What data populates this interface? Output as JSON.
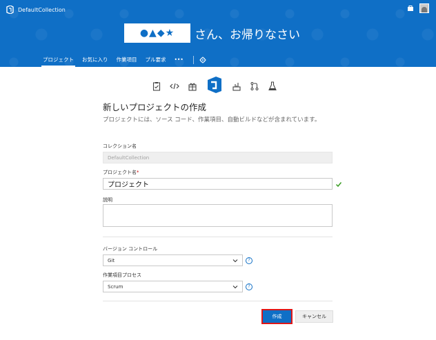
{
  "header": {
    "collection_name": "DefaultCollection",
    "user_name_masked": "●▲◆★",
    "welcome_text": "さん、お帰りなさい",
    "nav": [
      {
        "label": "プロジェクト"
      },
      {
        "label": "お気に入り"
      },
      {
        "label": "作業項目"
      },
      {
        "label": "プル要求"
      },
      {
        "label": "•••"
      }
    ]
  },
  "form": {
    "title": "新しいプロジェクトの作成",
    "description": "プロジェクトには、ソース コード、作業項目、自動ビルドなどが含まれています。",
    "collection_label": "コレクション名",
    "collection_value": "DefaultCollection",
    "project_label": "プロジェクト名",
    "project_value": "プロジェクト",
    "required_mark": "*",
    "description_label": "説明",
    "description_value": "",
    "version_control_label": "バージョン コントロール",
    "version_control_value": "Git",
    "process_label": "作業項目プロセス",
    "process_value": "Scrum",
    "help_glyph": "?",
    "create_label": "作成",
    "cancel_label": "キャンセル"
  },
  "colors": {
    "header_blue": "#0f6fc6",
    "highlight_red": "#e01616",
    "valid_green": "#3a9d23"
  },
  "icons": [
    "project-logo-icon",
    "bag-icon",
    "avatar",
    "gear-icon",
    "clipboard-icon",
    "code-icon",
    "gift-icon",
    "vs-logo-icon",
    "build-icon",
    "pull-request-icon",
    "flask-icon",
    "check-icon",
    "chevron-down-icon",
    "help-icon"
  ]
}
